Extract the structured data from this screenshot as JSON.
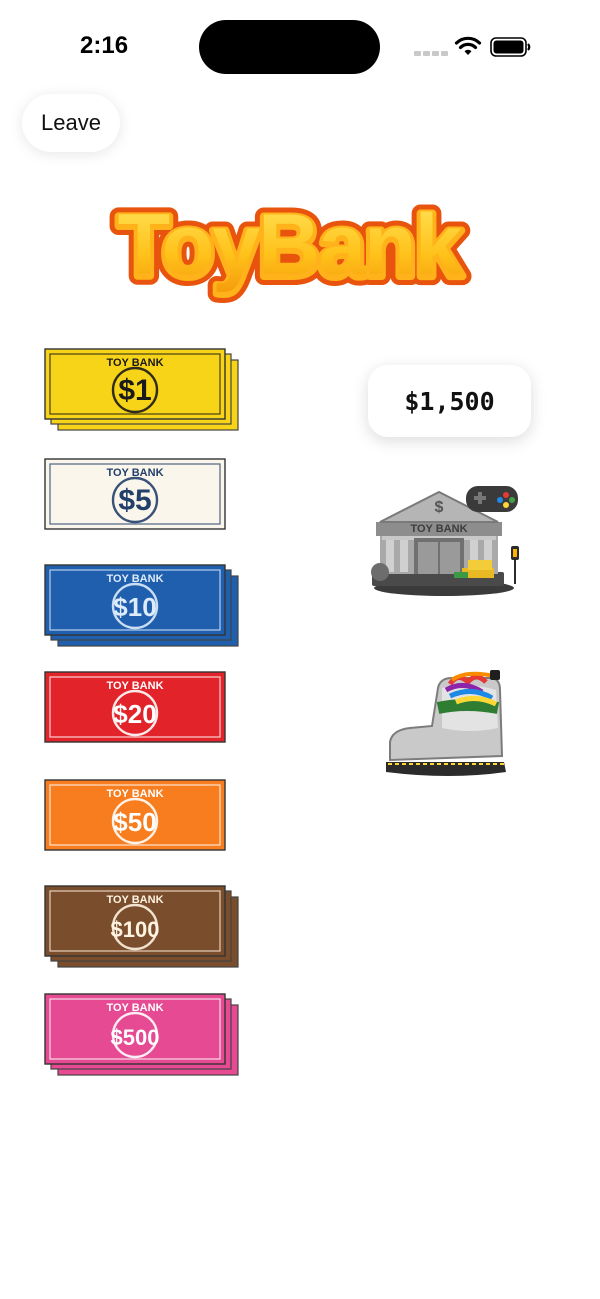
{
  "status_bar": {
    "time": "2:16",
    "icons": [
      "signal-icon",
      "wifi-icon",
      "battery-icon"
    ]
  },
  "leave_button": {
    "label": "Leave"
  },
  "logo": {
    "text": "ToyBank"
  },
  "bills": [
    {
      "denomination": "$1",
      "bank_text": "TOY BANK",
      "color": "#F7D418",
      "ink": "#1a1a1a",
      "stacked": true
    },
    {
      "denomination": "$5",
      "bank_text": "TOY BANK",
      "color": "#FBF6EC",
      "ink": "#23406B",
      "stacked": false
    },
    {
      "denomination": "$10",
      "bank_text": "TOY BANK",
      "color": "#1F5FAD",
      "ink": "#DDEBFA",
      "stacked": true
    },
    {
      "denomination": "$20",
      "bank_text": "TOY BANK",
      "color": "#E2232A",
      "ink": "#FFFFFF",
      "stacked": false
    },
    {
      "denomination": "$50",
      "bank_text": "TOY BANK",
      "color": "#F77D1F",
      "ink": "#FFFFFF",
      "stacked": false
    },
    {
      "denomination": "$100",
      "bank_text": "TOY BANK",
      "color": "#7A4E2C",
      "ink": "#FFF3E2",
      "stacked": true
    },
    {
      "denomination": "$500",
      "bank_text": "TOY BANK",
      "color": "#E54A93",
      "ink": "#FFFFFF",
      "stacked": true
    }
  ],
  "balance": {
    "amount": "$1,500"
  },
  "tokens": {
    "bank": {
      "label": "TOY BANK",
      "sign": "$",
      "icon": "bank-building-icon"
    },
    "boot": {
      "icon": "boot-token-icon"
    }
  }
}
